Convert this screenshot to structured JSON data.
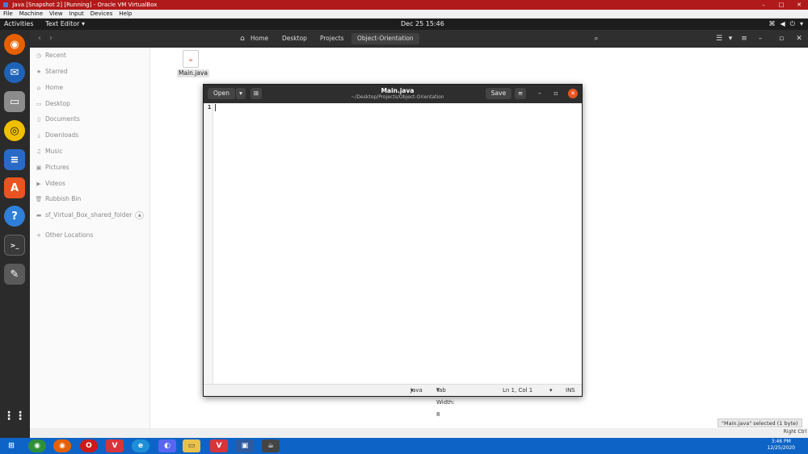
{
  "vbox": {
    "title": "Java [Snapshot 2] [Running] - Oracle VM VirtualBox",
    "menu": [
      "File",
      "Machine",
      "View",
      "Input",
      "Devices",
      "Help"
    ],
    "status_tooltip": "\"Main.java\" selected  (1 byte)",
    "host_key": "Right Ctrl"
  },
  "topbar": {
    "activities": "Activities",
    "app_menu": "Text Editor ▾",
    "clock": "Dec 25  15:46"
  },
  "files": {
    "breadcrumbs": [
      "Home",
      "Desktop",
      "Projects",
      "Object-Orientation"
    ],
    "sidebar": [
      {
        "label": "Recent",
        "icon": "clock-icon"
      },
      {
        "label": "Starred",
        "icon": "star-icon"
      },
      {
        "label": "Home",
        "icon": "home-icon"
      },
      {
        "label": "Desktop",
        "icon": "folder-icon"
      },
      {
        "label": "Documents",
        "icon": "document-icon"
      },
      {
        "label": "Downloads",
        "icon": "download-icon"
      },
      {
        "label": "Music",
        "icon": "music-icon"
      },
      {
        "label": "Pictures",
        "icon": "image-icon"
      },
      {
        "label": "Videos",
        "icon": "video-icon"
      },
      {
        "label": "Rubbish Bin",
        "icon": "trash-icon"
      },
      {
        "label": "sf_Virtual_Box_shared_folder",
        "icon": "drive-icon"
      },
      {
        "label": "Other Locations",
        "icon": "plus-icon"
      }
    ],
    "file_name": "Main.java"
  },
  "gedit": {
    "open_label": "Open",
    "save_label": "Save",
    "title": "Main.java",
    "subtitle": "~/Desktop/Projects/Object-Orientation",
    "line_number": "1",
    "status": {
      "language": "Java",
      "tab_width": "Tab Width: 8",
      "position": "Ln 1, Col 1",
      "mode": "INS"
    }
  },
  "taskbar": {
    "time": "3:46 PM",
    "date": "12/25/2020"
  }
}
